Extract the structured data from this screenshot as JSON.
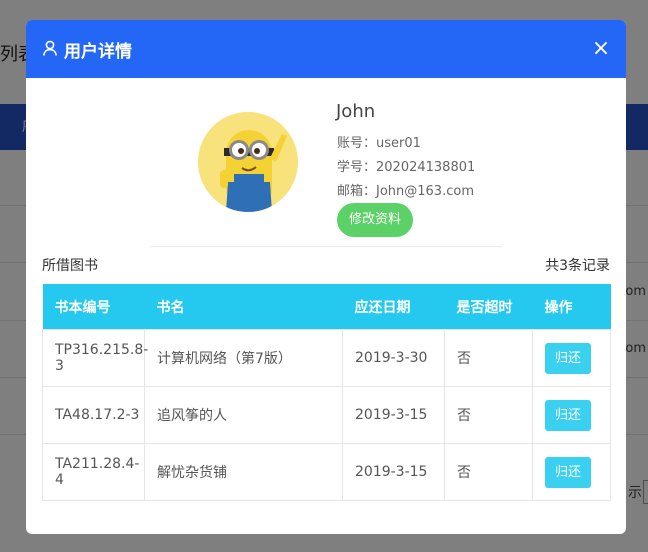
{
  "background": {
    "title_fragment": "列表",
    "band_fragment": "序",
    "cell_fragments": [
      "om",
      "om"
    ],
    "footer_fragment": "示"
  },
  "modal": {
    "title": "用户详情",
    "close_symbol": "×",
    "icons": {
      "header": "user-icon",
      "close": "close-icon"
    }
  },
  "profile": {
    "name": "John",
    "account": "账号：user01",
    "student_id": "学号：202024138801",
    "email": "邮箱：John@163.com",
    "edit_button": "修改资料"
  },
  "borrowed": {
    "label": "所借图书",
    "count": "共3条记录",
    "columns": [
      "书本编号",
      "书名",
      "应还日期",
      "是否超时",
      "操作"
    ],
    "rows": [
      {
        "id": "TP316.215.8-3",
        "title": "计算机网络（第7版）",
        "due": "2019-3-30",
        "overdue": "否",
        "action": "归还"
      },
      {
        "id": "TA48.17.2-3",
        "title": "追风筝的人",
        "due": "2019-3-15",
        "overdue": "否",
        "action": "归还"
      },
      {
        "id": "TA211.28.4-4",
        "title": "解忧杂货铺",
        "due": "2019-3-15",
        "overdue": "否",
        "action": "归还"
      }
    ]
  },
  "colors": {
    "header": "#2467f6",
    "table_header": "#25c8ee",
    "return_button": "#3ad0f0",
    "edit_button": "#5cd167"
  }
}
